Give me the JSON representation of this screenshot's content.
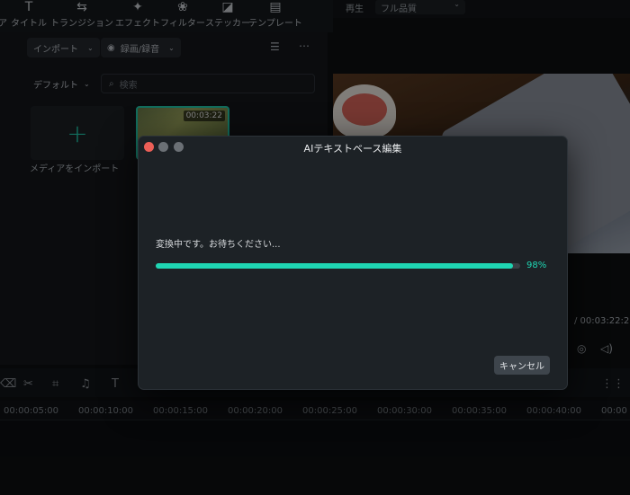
{
  "toolbar": {
    "items": [
      {
        "label": "ア",
        "icon": "text-icon",
        "glyph": ""
      },
      {
        "label": "タイトル",
        "icon": "title-icon",
        "glyph": "T"
      },
      {
        "label": "トランジション",
        "icon": "transition-icon",
        "glyph": "⇆"
      },
      {
        "label": "エフェクト",
        "icon": "effect-icon",
        "glyph": "✦"
      },
      {
        "label": "フィルター",
        "icon": "filter-icon",
        "glyph": "❀"
      },
      {
        "label": "ステッカー",
        "icon": "sticker-icon",
        "glyph": "◪"
      },
      {
        "label": "テンプレート",
        "icon": "template-icon",
        "glyph": "▤"
      }
    ]
  },
  "media": {
    "import_dropdown": "インポート",
    "record_dropdown": "録画/録音",
    "sort_dropdown": "デフォルト",
    "search_placeholder": "検索",
    "import_tile_label": "メディアをインポート",
    "clip_duration": "00:03:22"
  },
  "preview": {
    "playback_label": "再生",
    "quality": "フル品質",
    "timecode": "/ 00:03:22:2"
  },
  "timeline": {
    "ticks": [
      "00:00:05:00",
      "00:00:10:00",
      "00:00:15:00",
      "00:00:20:00",
      "00:00:25:00",
      "00:00:30:00",
      "00:00:35:00",
      "00:00:40:00",
      "00:00"
    ]
  },
  "dialog": {
    "title": "AIテキストベース編集",
    "message": "変換中です。お待ちください...",
    "progress": 0.98,
    "progress_text": "98%",
    "cancel_label": "キャンセル",
    "accent": "#1fd6b3"
  }
}
